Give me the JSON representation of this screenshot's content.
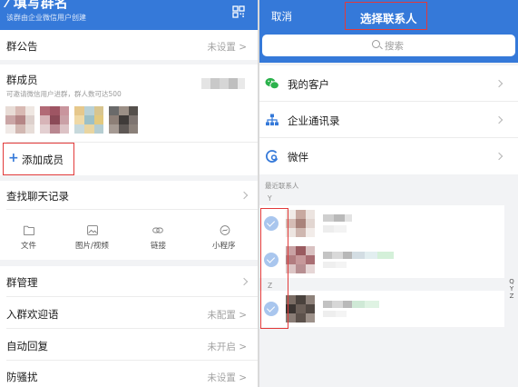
{
  "left": {
    "header": {
      "title": "⁄ 填写群名",
      "subtitle": "该群由企业微信用户创建"
    },
    "announcement": {
      "label": "群公告",
      "value": "未设置 >"
    },
    "members": {
      "label": "群成员",
      "hint": "可邀请微信用户进群，群人数可达500",
      "add_label": "添加成员",
      "plus_symbol": "+"
    },
    "find_chat": {
      "label": "查找聊天记录"
    },
    "files": [
      {
        "label": "文件",
        "icon": "folder-icon"
      },
      {
        "label": "图片/视频",
        "icon": "image-icon"
      },
      {
        "label": "链接",
        "icon": "link-icon"
      },
      {
        "label": "小程序",
        "icon": "mini-program-icon"
      }
    ],
    "settings": [
      {
        "label": "群管理",
        "value": ""
      },
      {
        "label": "入群欢迎语",
        "value": "未配置 >"
      },
      {
        "label": "自动回复",
        "value": "未开启 >"
      },
      {
        "label": "防骚扰",
        "value": "未设置 >"
      }
    ]
  },
  "right": {
    "header": {
      "cancel": "取消",
      "title": "选择联系人"
    },
    "search": {
      "placeholder": "搜索"
    },
    "categories": [
      {
        "label": "我的客户",
        "icon": "wechat-customer-icon",
        "color": "#2bb24c"
      },
      {
        "label": "企业通讯录",
        "icon": "org-chart-icon",
        "color": "#3579d9"
      },
      {
        "label": "微伴",
        "icon": "weiban-app-icon",
        "color": "#3579d9"
      }
    ],
    "recent_label": "最近联系人",
    "groups": [
      {
        "letter": "Y"
      },
      {
        "letter": "Z"
      }
    ],
    "index_bar": [
      "Q",
      "Y",
      "Z"
    ]
  },
  "colors": {
    "primary": "#3579d9",
    "highlight": "#e23a3a",
    "check": "#a9c6ee"
  }
}
